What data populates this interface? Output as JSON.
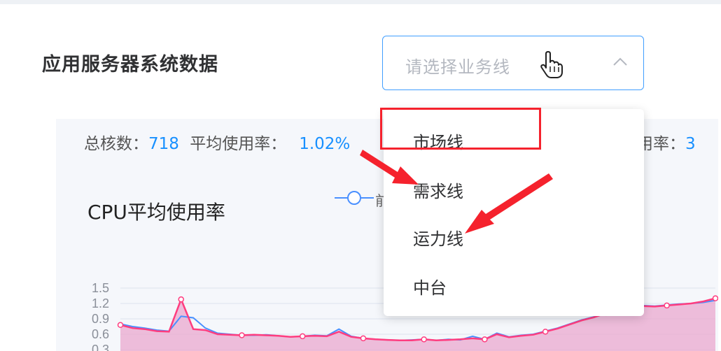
{
  "page_title": "应用服务器系统数据",
  "select": {
    "placeholder": "请选择业务线",
    "options": [
      "市场线",
      "需求线",
      "运力线",
      "中台"
    ]
  },
  "stats": {
    "total_cores_label": "总核数：",
    "total_cores_value": "718",
    "avg_usage_label": "平均使用率：",
    "avg_usage_value": "1.02%",
    "partial_label": "用率：",
    "partial_value": "3"
  },
  "chart_data": {
    "type": "line",
    "title": "CPU平均使用率",
    "legend_partial": "前",
    "y_ticks": [
      "1.5",
      "1.2",
      "0.9",
      "0.6",
      "0.3"
    ],
    "series": [
      {
        "values": [
          0.8,
          0.75,
          0.72,
          0.68,
          0.66,
          0.95,
          0.92,
          0.72,
          0.62,
          0.6,
          0.58,
          0.58,
          0.59,
          0.57,
          0.55,
          0.56,
          0.58,
          0.57,
          0.7,
          0.56,
          0.52,
          0.5,
          0.49,
          0.48,
          0.49,
          0.5,
          0.48,
          0.5,
          0.49,
          0.56,
          0.5,
          0.62,
          0.55,
          0.58,
          0.6,
          0.66,
          0.72,
          0.8,
          0.88,
          0.94,
          1.02,
          1.08,
          1.12,
          1.16,
          1.15,
          1.17,
          1.19,
          1.2,
          1.22,
          1.26
        ]
      },
      {
        "values": [
          0.78,
          0.72,
          0.7,
          0.66,
          0.65,
          1.28,
          0.7,
          0.68,
          0.6,
          0.59,
          0.58,
          0.59,
          0.58,
          0.57,
          0.55,
          0.56,
          0.57,
          0.56,
          0.65,
          0.55,
          0.52,
          0.5,
          0.49,
          0.48,
          0.48,
          0.5,
          0.48,
          0.49,
          0.5,
          0.52,
          0.5,
          0.6,
          0.54,
          0.57,
          0.59,
          0.65,
          0.71,
          0.79,
          0.87,
          0.93,
          1.01,
          1.07,
          1.11,
          1.15,
          1.14,
          1.16,
          1.18,
          1.2,
          1.24,
          1.3
        ]
      }
    ],
    "colors": {
      "series_a": "#4a90ff",
      "series_b": "#ff3d7f",
      "area": "#e9a8cf"
    },
    "ylim": [
      0.3,
      1.5
    ]
  }
}
